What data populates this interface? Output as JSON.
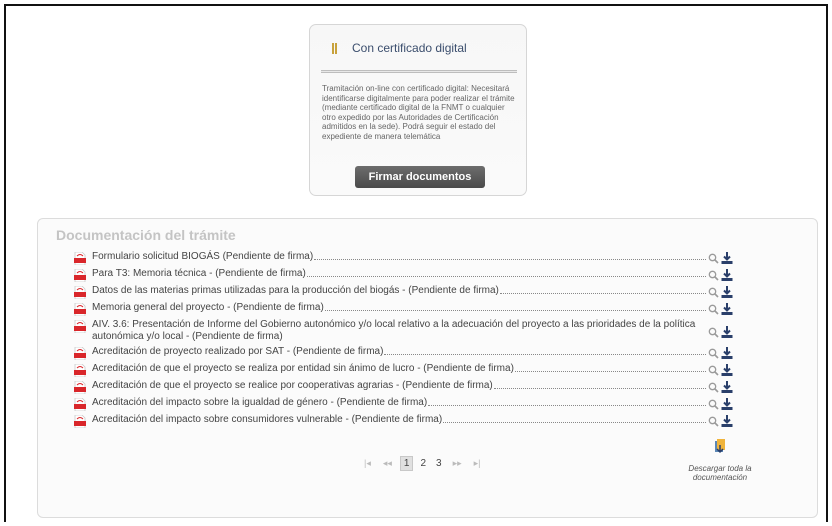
{
  "certificate": {
    "title": "Con certificado digital",
    "description": "Tramitación on-line con certificado digital: Necesitará identificarse digitalmente para poder realizar el trámite (mediante certificado digital de la FNMT o cualquier otro expedido por las Autoridades de Certificación admitidos en la sede). Podrá seguir el estado del expediente de manera telemática",
    "button_label": "Firmar documentos",
    "icon": "certificate-icon"
  },
  "documentation": {
    "title": "Documentación del trámite",
    "items": [
      {
        "label": "Formulario solicitud BIOGÁS (Pendiente de firma)"
      },
      {
        "label": "Para T3: Memoria técnica - (Pendiente de firma)"
      },
      {
        "label": "Datos de las materias primas utilizadas para la producción del biogás - (Pendiente de firma)"
      },
      {
        "label": "Memoria general del proyecto - (Pendiente de firma)"
      },
      {
        "label": "AIV. 3.6: Presentación de Informe del Gobierno autonómico y/o local relativo a la adecuación del proyecto a las prioridades de la política autonómica y/o local - (Pendiente de firma)"
      },
      {
        "label": "Acreditación de proyecto realizado por SAT - (Pendiente de firma)"
      },
      {
        "label": "Acreditación de que el proyecto se realiza por entidad sin ánimo de lucro - (Pendiente de firma)"
      },
      {
        "label": "Acreditación de que el proyecto se realice por cooperativas agrarias - (Pendiente de firma)"
      },
      {
        "label": "Acreditación del impacto sobre la igualdad de género - (Pendiente de firma)"
      },
      {
        "label": "Acreditación del impacto sobre consumidores vulnerable - (Pendiente de firma)"
      }
    ],
    "pagination": {
      "first": "|◂",
      "prev": "◂◂",
      "pages": [
        "1",
        "2",
        "3"
      ],
      "current": "1",
      "next": "▸▸",
      "last": "▸|"
    },
    "download_all": "Descargar toda la documentación"
  },
  "colors": {
    "title_blue": "#3b4e6d",
    "pdf_red": "#d9262a",
    "button_gray": "#555555",
    "download_blue": "#2a3f6a"
  }
}
